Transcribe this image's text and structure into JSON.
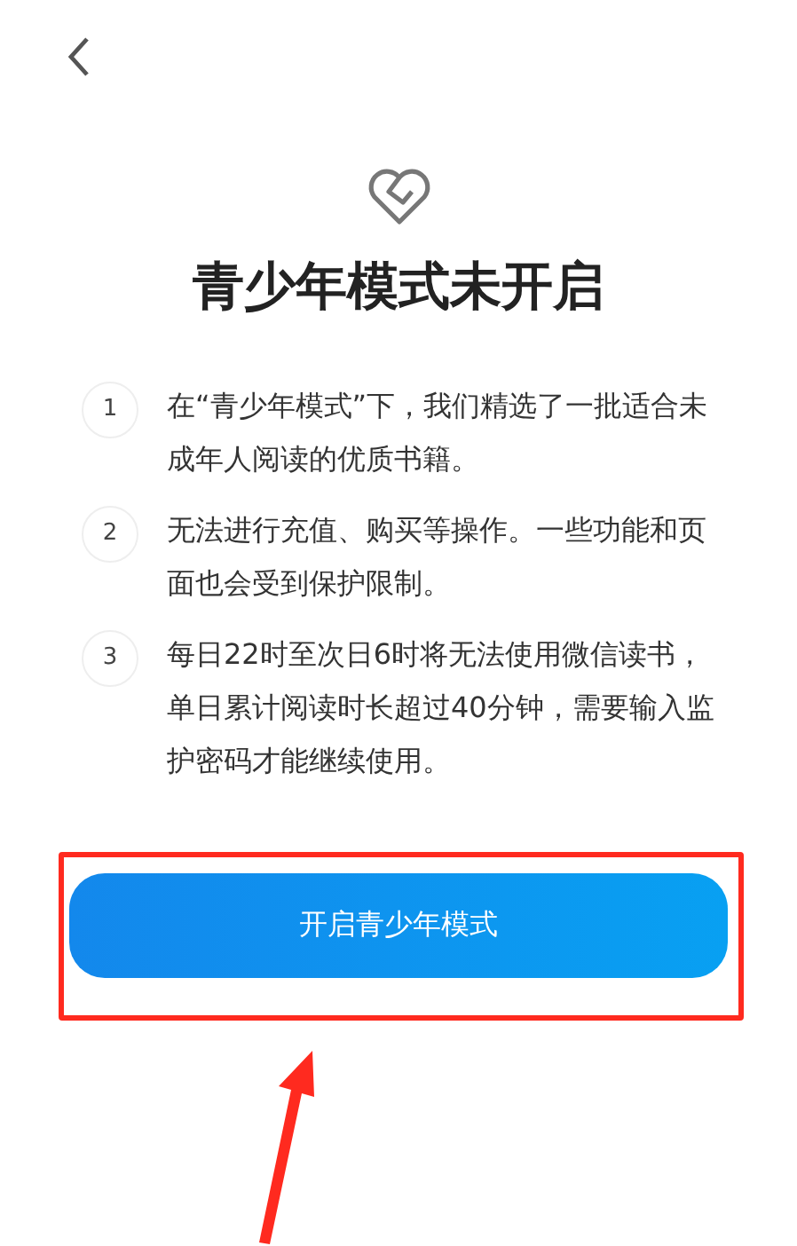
{
  "title": "青少年模式未开启",
  "items": [
    {
      "number": "1",
      "text": "在“青少年模式”下，我们精选了一批适合未成年人阅读的优质书籍。"
    },
    {
      "number": "2",
      "text": "无法进行充值、购买等操作。一些功能和页面也会受到保护限制。"
    },
    {
      "number": "3",
      "text": "每日22时至次日6时将无法使用微信读书，单日累计阅读时长超过40分钟，需要输入监护密码才能继续使用。"
    }
  ],
  "button": {
    "label": "开启青少年模式"
  }
}
